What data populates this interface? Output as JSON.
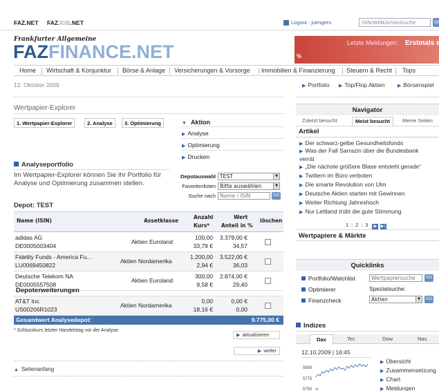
{
  "topbar": {
    "link1": "FAZ.NET",
    "link2_a": "FAZ",
    "link2_b": "JOB",
    "link2_c": ".NET",
    "logout": "Logout : juengers",
    "search_placeholder": "ISIN/WKN/Artikelsuche",
    "go": "GO"
  },
  "logo": {
    "small": "Frankfurter Allgemeine",
    "faz": "FAZ",
    "finance": "FINANCE.NET"
  },
  "ticker": {
    "label": "Letzte Meldungen:",
    "headline": "Erstmals ein",
    "percent": "%"
  },
  "nav": [
    "Home",
    "Wirtschaft & Konjunktur",
    "Börse & Anlage",
    "Versicherungen & Vorsorge",
    "Immobilien & Finanzierung",
    "Steuern & Recht",
    "Tops"
  ],
  "date": "12. Oktober 2009",
  "toplinks": [
    "Portfolio",
    "Top/Flop Aktien",
    "Börsenspiel"
  ],
  "explorer": {
    "title": "Wertpapier-Explorer",
    "tabs": [
      "1. Wertpapier-Explorer",
      "2. Analyse",
      "3. Optimierung"
    ],
    "aktion_title": "Aktion",
    "aktion_items": [
      "Analyse",
      "Optimierung",
      "Drucken"
    ]
  },
  "analyse": {
    "title": "Analyseportfolio",
    "text": "Im Wertpapier-Explorer können Sie Ihr Portfolio für Analyse und Optimierung zusammen stellen.",
    "depot_label": "Depotauswahl",
    "depot_value": "TEST",
    "fav_label": "Favoritenlisten",
    "fav_value": "Bitte auswählen",
    "search_label": "Suche nach",
    "search_placeholder": "Name / ISIN",
    "go": "GO"
  },
  "depot": {
    "title": "Depot: TEST",
    "headers": {
      "name": "Name (ISIN)",
      "asset": "Assetklasse",
      "anzahl1": "Anzahl",
      "anzahl2": "Kurs*",
      "wert1": "Wert",
      "wert2": "Anteil in %",
      "loeschen": "löschen"
    },
    "rows": [
      {
        "name": "adidas AG",
        "isin": "DE0005003404",
        "asset": "Aktien Euroland",
        "anzahl": "100,00",
        "kurs": "33,79 €",
        "wert": "3.379,00 €",
        "anteil": "34,57"
      },
      {
        "name": "Fidelity Funds - America Fu...",
        "isin": "LU0069450822",
        "asset": "Aktien Nordamerika",
        "anzahl": "1.200,00",
        "kurs": "2,94 €",
        "wert": "3.522,00 €",
        "anteil": "36,03"
      },
      {
        "name": "Deutsche Telekom NA",
        "isin": "DE0005557508",
        "asset": "Aktien Euroland",
        "anzahl": "300,00",
        "kurs": "9,58 €",
        "wert": "2.874,00 €",
        "anteil": "29,40"
      }
    ],
    "section": "Depoterweiterungen",
    "ext_row": {
      "name": "AT&T Inc.",
      "isin": "US00206R1023",
      "asset": "Aktien Nordamerika",
      "anzahl": "0,00",
      "kurs": "18,16 €",
      "wert": "0,00 €",
      "anteil": "0,00"
    },
    "total_label": "Gesamtwert Analysedepot:",
    "total_value": "9.775,00 €",
    "footnote": "* Schlusskurs letzter Handelstag vor der Analyse",
    "btn_update": "aktualisieren",
    "btn_next": "weiter",
    "top_link": "Seitenanfang"
  },
  "navigator": {
    "title": "Navigator",
    "tabs": [
      "Zuletzt besucht",
      "Meist besucht",
      "Meine Seiten"
    ],
    "section": "Artikel",
    "items": [
      "Der schwarz-gelbe Gesundheitsfonds",
      "Was der Fall Sarrazin über die Bundesbank verrät",
      "„Die nächste größere Blase entsteht gerade“",
      "Twittern im Büro verboten",
      "Die smarte Revolution von Ulm",
      "Deutsche Aktien starten mit Gewinnen",
      "Weiter Richtung Jahreshoch",
      "Nur Lettland trübt die gute Stimmung"
    ],
    "pages": [
      "1",
      "2",
      "3"
    ],
    "wpm": "Wertpapiere & Märkte"
  },
  "quicklinks": {
    "title": "Quicklinks",
    "items": [
      "Portfolio/Watchlist",
      "Optimierer",
      "Finanzcheck"
    ],
    "search_placeholder": "Wertpapiersuche",
    "spezial_label": "Spezialsuche:",
    "spezial_value": "Aktien",
    "go": "GO"
  },
  "indizes": {
    "title": "Indizes",
    "tabs": [
      "Dax",
      "Tec",
      "Dow",
      "Nas"
    ],
    "datetime": "12.10.2009 | 16:45",
    "links": [
      "Übersicht",
      "Zusammensetzung",
      "Chart",
      "Meldungen"
    ],
    "y_ticks": [
      "5800",
      "5775",
      "5750"
    ]
  },
  "colors": {
    "brand": "#2d5a8c",
    "accent": "#4773ad",
    "ticker": "#c9443a"
  }
}
